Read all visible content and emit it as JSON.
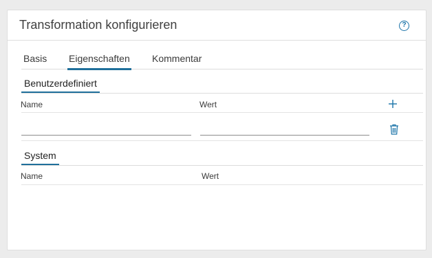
{
  "dialog": {
    "title": "Transformation konfigurieren",
    "help_symbol": "?"
  },
  "tabs": [
    {
      "label": "Basis",
      "active": false
    },
    {
      "label": "Eigenschaften",
      "active": true
    },
    {
      "label": "Kommentar",
      "active": false
    }
  ],
  "custom_section": {
    "title": "Benutzerdefiniert",
    "columns": {
      "name": "Name",
      "value": "Wert"
    },
    "rows": [
      {
        "name": "",
        "value": ""
      }
    ]
  },
  "system_section": {
    "title": "System",
    "columns": {
      "name": "Name",
      "value": "Wert"
    }
  },
  "colors": {
    "accent": "#1f6f9b",
    "icon_blue": "#1a73a8"
  },
  "icons": {
    "help": "help-circle-icon",
    "add": "plus-icon",
    "delete": "trash-icon"
  }
}
